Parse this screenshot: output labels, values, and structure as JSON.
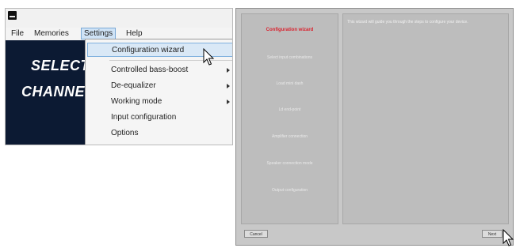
{
  "app": {
    "menubar": {
      "file": "File",
      "memories": "Memories",
      "settings": "Settings",
      "help": "Help"
    },
    "panel": {
      "select_text": "SELECT",
      "channel_text": "CHANNE"
    }
  },
  "settings_menu": {
    "items": [
      {
        "label": "Configuration wizard",
        "selected": true,
        "submenu": false
      },
      {
        "label": "Controlled bass-boost",
        "selected": false,
        "submenu": true
      },
      {
        "label": "De-equalizer",
        "selected": false,
        "submenu": true
      },
      {
        "label": "Working mode",
        "selected": false,
        "submenu": true
      },
      {
        "label": "Input configuration",
        "selected": false,
        "submenu": false
      },
      {
        "label": "Options",
        "selected": false,
        "submenu": false
      }
    ]
  },
  "wizard": {
    "steps": [
      "Configuration wizard",
      "Select input combinations",
      "Load mini dash",
      "Ld end-point",
      "Amplifier connection",
      "Speaker connection mode",
      "Output configuration"
    ],
    "active_step": 0,
    "description": "This wizard will guide you through the steps to configure your device.",
    "cancel_label": "Cancel",
    "next_label": "Next"
  },
  "colors": {
    "dark_panel": "#0c1a33",
    "highlight": "#d9e8f6",
    "active_step": "#d9232f",
    "wizard_bg": "#c8c8c8"
  }
}
